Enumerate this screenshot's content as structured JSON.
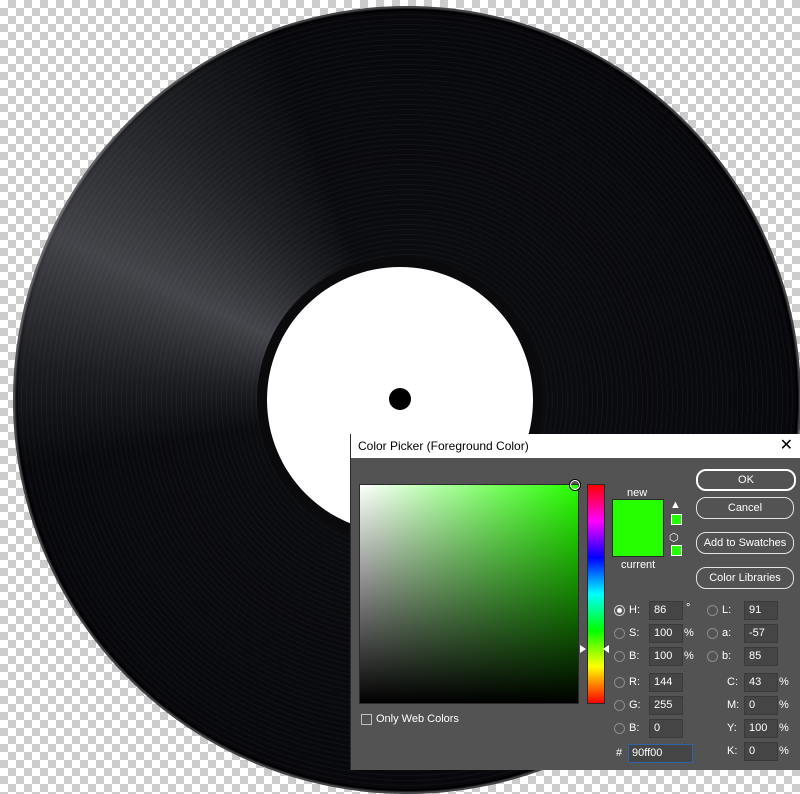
{
  "dialog": {
    "title": "Color Picker (Foreground Color)",
    "close_glyph": "✕"
  },
  "swatch": {
    "new_label": "new",
    "current_label": "current",
    "new_color": "#26ff00",
    "current_color": "#26ff00"
  },
  "buttons": {
    "ok": "OK",
    "cancel": "Cancel",
    "add_to_swatches": "Add to Swatches",
    "color_libraries": "Color Libraries"
  },
  "hsb": {
    "h_label": "H:",
    "h_value": "86",
    "h_unit": "°",
    "s_label": "S:",
    "s_value": "100",
    "s_unit": "%",
    "b_label": "B:",
    "b_value": "100",
    "b_unit": "%"
  },
  "rgb": {
    "r_label": "R:",
    "r_value": "144",
    "g_label": "G:",
    "g_value": "255",
    "b_label": "B:",
    "b_value": "0"
  },
  "lab": {
    "l_label": "L:",
    "l_value": "91",
    "a_label": "a:",
    "a_value": "-57",
    "b_label": "b:",
    "b_value": "85"
  },
  "cmyk": {
    "c_label": "C:",
    "c_value": "43",
    "c_unit": "%",
    "m_label": "M:",
    "m_value": "0",
    "m_unit": "%",
    "y_label": "Y:",
    "y_value": "100",
    "y_unit": "%",
    "k_label": "K:",
    "k_value": "0",
    "k_unit": "%"
  },
  "hex": {
    "hash": "#",
    "value": "90ff00"
  },
  "only_web_colors_label": "Only Web Colors",
  "colors": {
    "dialog_bg": "#535353",
    "picked": "#26ff00",
    "record": "#050609"
  }
}
